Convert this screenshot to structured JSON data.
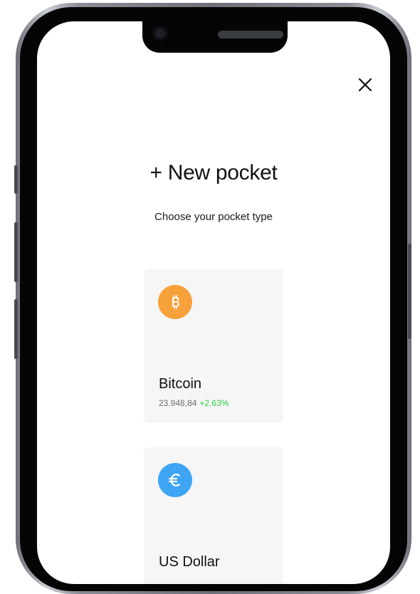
{
  "header": {
    "close_icon": "close-icon",
    "title": "+ New pocket",
    "subtitle": "Choose your pocket type"
  },
  "pockets": [
    {
      "name": "Bitcoin",
      "price": "23.948,84",
      "change": "+2.63%",
      "icon": "bitcoin-icon",
      "icon_color": "#F7A13A",
      "change_color": "#2ECC40"
    },
    {
      "name": "US Dollar",
      "icon": "euro-icon",
      "icon_color": "#3DA5F4"
    }
  ]
}
